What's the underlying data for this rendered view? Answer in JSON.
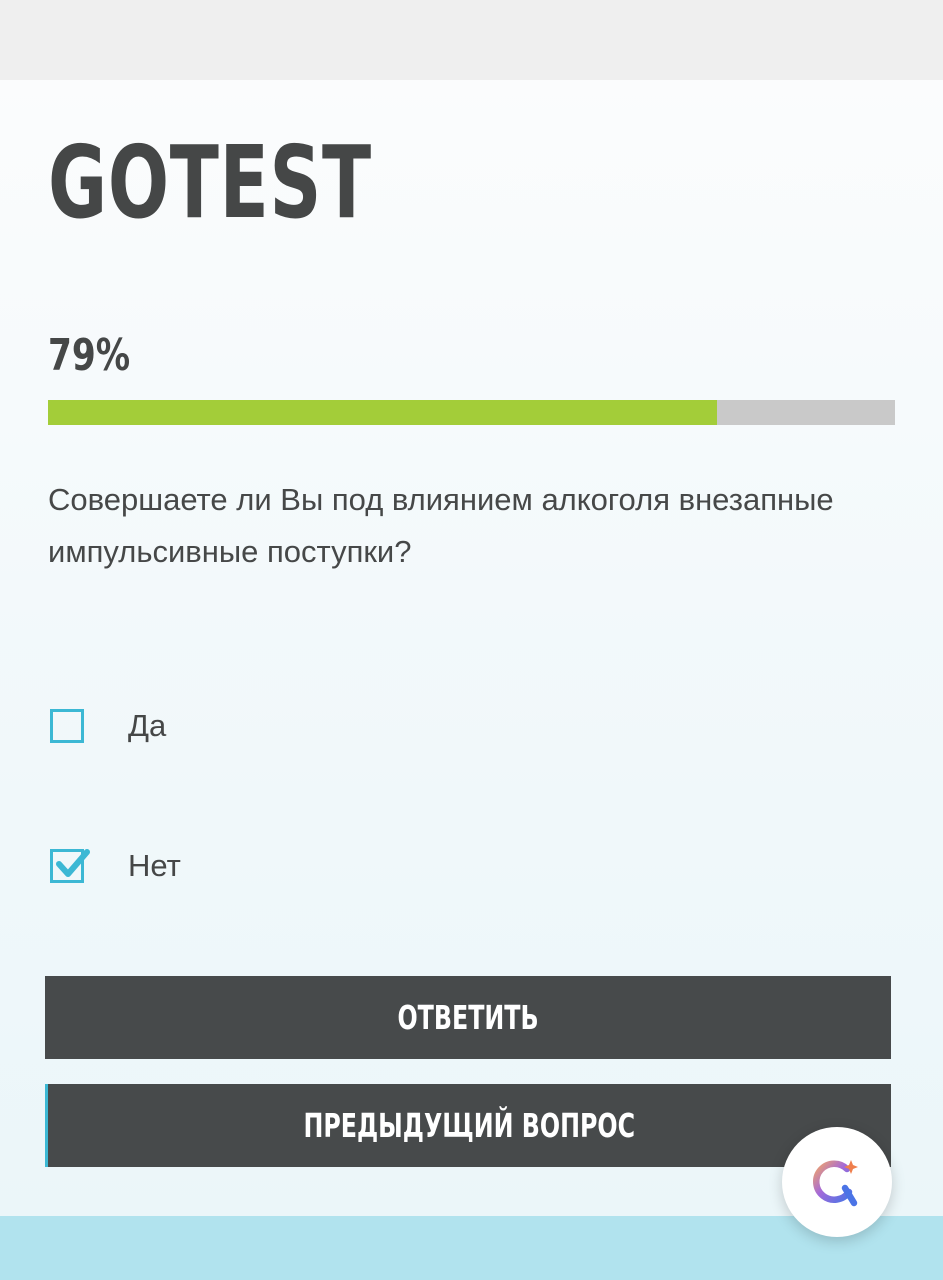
{
  "header": {
    "logo_text": "GOTEST"
  },
  "progress": {
    "label": "79%",
    "fraction": 0.79,
    "fill_color": "#a3cd39",
    "track_color": "#c9c9c9"
  },
  "question": {
    "text": "Совершаете ли Вы под влиянием алкоголя внезапные импульсивные поступки?"
  },
  "options": [
    {
      "label": "Да",
      "checked": false
    },
    {
      "label": "Нет",
      "checked": true
    }
  ],
  "buttons": {
    "answer_label": "ОТВЕТИТЬ",
    "previous_label": "ПРЕДЫДУЩИЙ ВОПРОС"
  },
  "fab": {
    "icon": "assistant-search-icon"
  },
  "colors": {
    "accent": "#3cb8d4",
    "button_bg": "#474a4b",
    "text": "#454747",
    "footer": "#b1e3ee"
  }
}
